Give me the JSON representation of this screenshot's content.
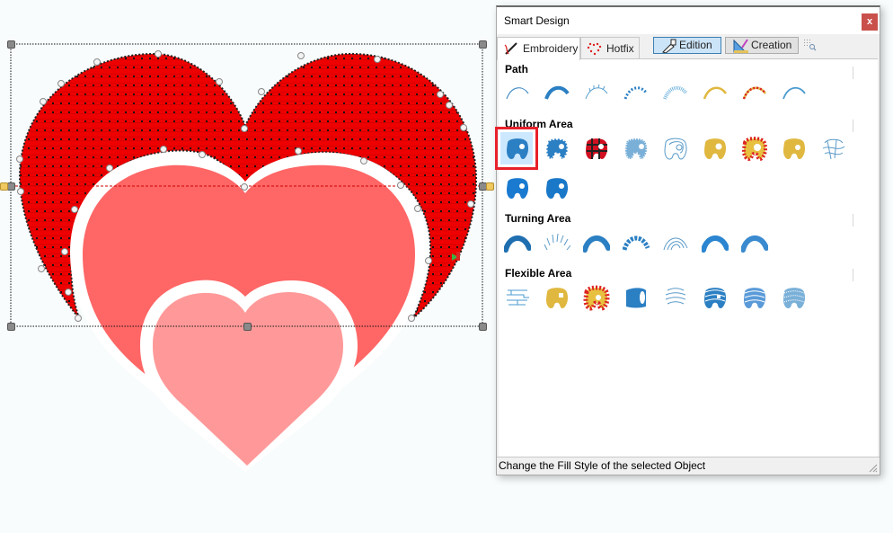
{
  "canvas": {
    "colors": {
      "outer_heart": "#ee0000",
      "middle_heart": "#ff6666",
      "inner_heart": "#ff9999",
      "background": "#f8fcfc",
      "selection_accent": "#cc0000"
    }
  },
  "panel": {
    "title": "Smart Design",
    "close_label": "x",
    "tabs": [
      {
        "label": "Embroidery",
        "icon": "needle-icon",
        "active": true
      },
      {
        "label": "Hotfix",
        "icon": "rhinestone-heart-icon",
        "active": false
      }
    ],
    "mode_buttons": [
      {
        "label": "Edition",
        "icon": "edit-pen-icon",
        "active": true
      },
      {
        "label": "Creation",
        "icon": "ruler-square-icon",
        "active": false
      }
    ],
    "grid_icon": "grid-zoom-icon",
    "sections": [
      {
        "title": "Path",
        "items": [
          "running-stitch-path",
          "satin-path",
          "e-stitch-path",
          "bead-path",
          "pattern-path",
          "yellow-satin-path",
          "red-beaded-path",
          "thin-line-path"
        ]
      },
      {
        "title": "Uniform Area",
        "items": [
          "tatami-fill",
          "checker-fill",
          "tartan-fill",
          "crosshatch-fill",
          "contour-fill",
          "gradient-yellow-fill",
          "candy-stripe-fill",
          "yellow-grid-fill",
          "stipple-fill",
          "blue-textured-fill",
          "blue-textured-fill-2"
        ],
        "selected_index": 0
      },
      {
        "title": "Turning Area",
        "items": [
          "satin-turning",
          "radial-lines-turning",
          "tatami-turning",
          "bead-turning",
          "contour-turning",
          "gradient-turning",
          "textured-turning"
        ]
      },
      {
        "title": "Flexible Area",
        "items": [
          "maze-fill",
          "yellow-motif-fill",
          "red-yellow-motif-fill",
          "satin-flex-fill",
          "wave-lines-fill",
          "wave-satin-fill",
          "wave-dense-fill",
          "wave-dotted-fill"
        ]
      }
    ],
    "status_text": "Change the Fill Style of the selected Object",
    "colors": {
      "accent_blue": "#2b7fc3",
      "selected_bg": "#cce8ff",
      "selection_red": "#e8202a",
      "close_bg": "#c9504b"
    }
  }
}
